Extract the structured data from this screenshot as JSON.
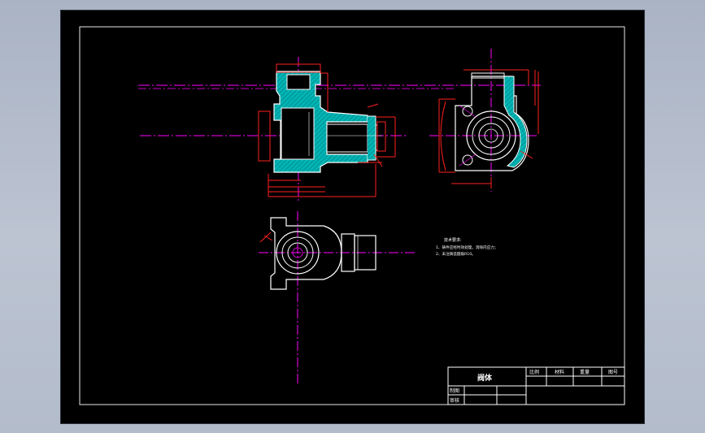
{
  "notes": {
    "title": "技术要求:",
    "line1": "1、铸件应经时效处理，消除内应力；",
    "line2": "2、未注铸造圆角R10。"
  },
  "title_block": {
    "part_name": "阀体",
    "col_scale": "比例",
    "col_material": "材料",
    "col_weight": "重量",
    "col_sheet": "图号",
    "drawn_by": "制图",
    "checked_by": "审核"
  },
  "colors": {
    "background": "#000000",
    "outline": "#ffffff",
    "dimension": "#ff2020",
    "centerline": "#ff00ff",
    "hatch": "#00c8c8"
  }
}
